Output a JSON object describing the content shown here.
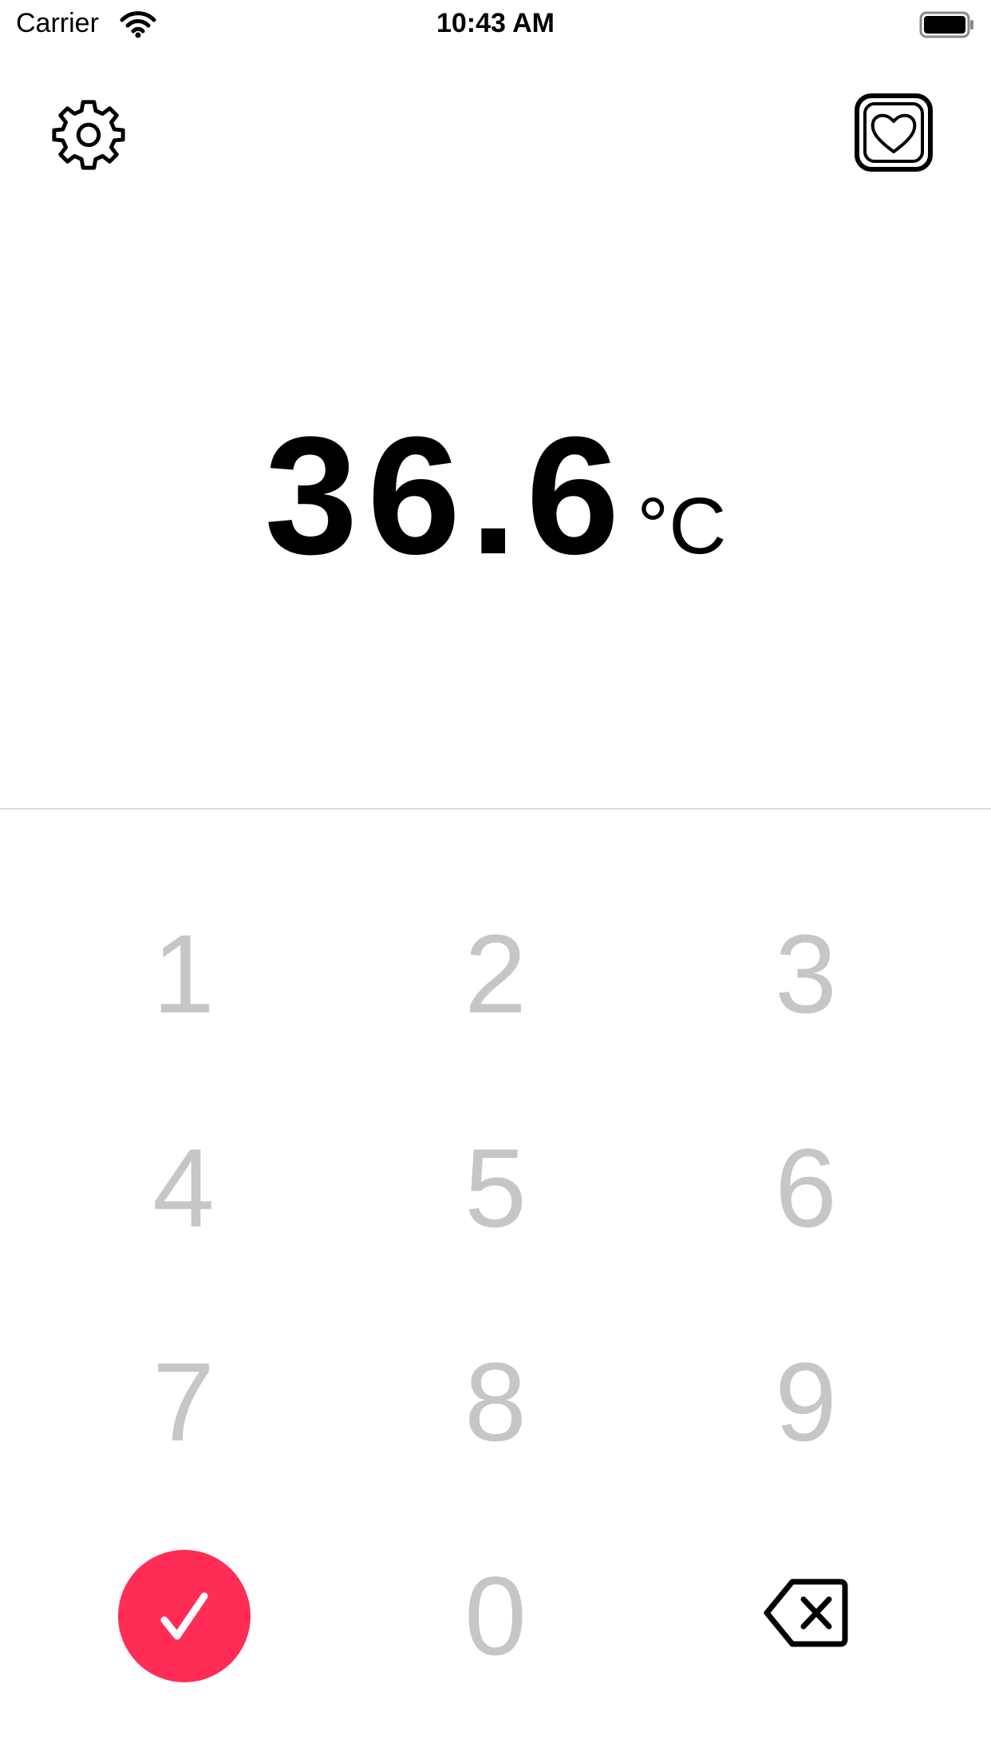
{
  "status_bar": {
    "carrier": "Carrier",
    "time": "10:43 AM",
    "wifi_icon": "wifi-icon",
    "battery_icon": "battery-icon"
  },
  "header": {
    "settings_icon": "gear-icon",
    "health_icon": "heart-square-icon"
  },
  "reading": {
    "value": "36.6",
    "unit": "°C"
  },
  "keypad": {
    "keys": [
      "1",
      "2",
      "3",
      "4",
      "5",
      "6",
      "7",
      "8",
      "9",
      "0"
    ],
    "confirm_icon": "checkmark-icon",
    "backspace_icon": "backspace-icon"
  },
  "colors": {
    "accent": "#ff2d55",
    "key_text": "#c6c6c8",
    "divider": "#dcdcdc",
    "reading_text": "#000000"
  }
}
